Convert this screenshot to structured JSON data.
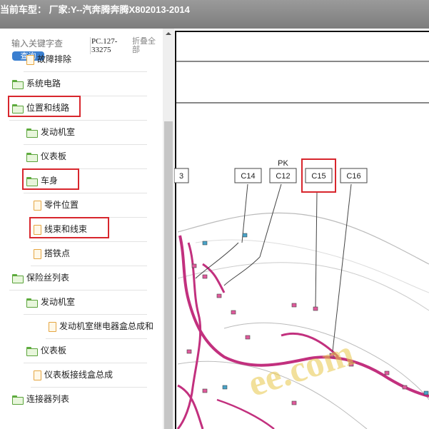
{
  "header": {
    "title": "当前车型： 厂家:Y--汽奔腾奔腾X802013-2014"
  },
  "search": {
    "placeholder": "输入关键字查",
    "button": "查询",
    "pc_code": "PC.127-33275",
    "collapse": "折叠全部"
  },
  "tree": [
    {
      "label": "故障排除",
      "type": "doc"
    },
    {
      "label": "系统电路",
      "type": "folder"
    },
    {
      "label": "位置和线路",
      "type": "folder",
      "highlighted": true
    },
    {
      "label": "发动机室",
      "type": "folder"
    },
    {
      "label": "仪表板",
      "type": "folder"
    },
    {
      "label": "车身",
      "type": "folder",
      "highlighted": true
    },
    {
      "label": "零件位置",
      "type": "doc"
    },
    {
      "label": "线束和线束",
      "type": "doc",
      "highlighted": true
    },
    {
      "label": "搭铁点",
      "type": "doc"
    },
    {
      "label": "保险丝列表",
      "type": "folder"
    },
    {
      "label": "发动机室",
      "type": "folder"
    },
    {
      "label": "发动机室继电器盒总成和",
      "type": "doc"
    },
    {
      "label": "仪表板",
      "type": "folder"
    },
    {
      "label": "仪表板接线盒总成",
      "type": "doc"
    },
    {
      "label": "连接器列表",
      "type": "folder"
    }
  ],
  "diagram": {
    "connectors": [
      {
        "label": "3"
      },
      {
        "label": "C14"
      },
      {
        "label": "C12",
        "note": "PK"
      },
      {
        "label": "C15",
        "highlighted": true
      },
      {
        "label": "C16"
      }
    ],
    "watermark": "ee.com",
    "colors": {
      "harness": "#c2307e",
      "highlight": "#d8262d",
      "watermark": "#e9c84a"
    }
  }
}
